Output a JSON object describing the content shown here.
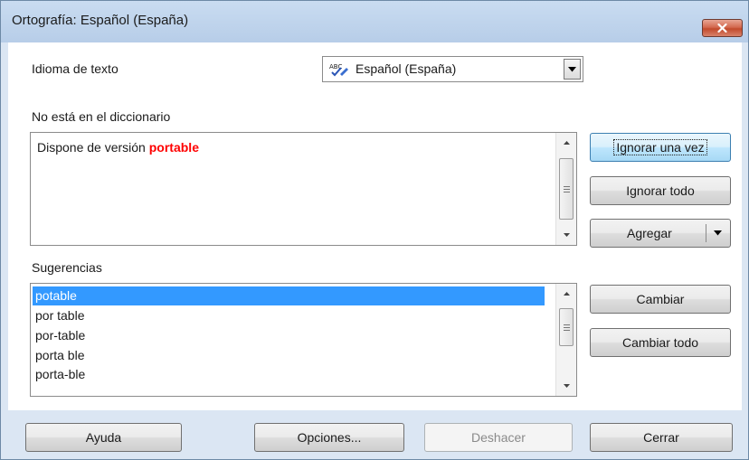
{
  "window": {
    "title": "Ortografía: Español (España)"
  },
  "text_language": {
    "label": "Idioma de texto",
    "value": "Español (España)",
    "icon": "spellcheck-abc-icon"
  },
  "not_in_dictionary": {
    "label": "No está en el diccionario",
    "sentence_before": "Dispone de versión ",
    "error_word": "portable",
    "error_color": "#ff0000"
  },
  "suggestions": {
    "label": "Sugerencias",
    "items": [
      "potable",
      "por table",
      "por-table",
      "porta ble",
      "porta-ble"
    ],
    "selected_index": 0
  },
  "buttons": {
    "ignore_once": "Ignorar una vez",
    "ignore_all": "Ignorar todo",
    "add": "Agregar",
    "change": "Cambiar",
    "change_all": "Cambiar todo",
    "help": "Ayuda",
    "options": "Opciones...",
    "undo": "Deshacer",
    "close": "Cerrar"
  },
  "colors": {
    "selection": "#3399ff",
    "dialog_background": "#dbe6f3",
    "close_button": "#c24a2c"
  }
}
